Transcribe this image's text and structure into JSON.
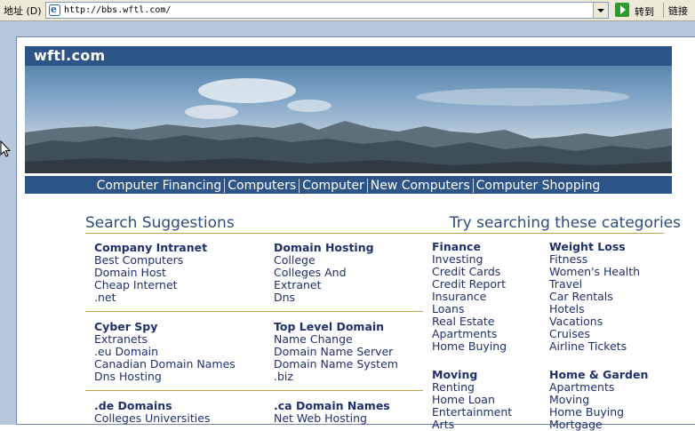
{
  "browser": {
    "address_label": "地址 (D)",
    "url": "http://bbs.wftl.com/",
    "go_label": "转到",
    "links_label": "链接"
  },
  "site": {
    "title": "wftl.com",
    "nav": [
      "Computer Financing",
      "Computers",
      "Computer",
      "New Computers",
      "Computer Shopping"
    ]
  },
  "suggestions": {
    "title": "Search Suggestions",
    "groups": [
      {
        "heading": "Company Intranet",
        "items": [
          "Best Computers",
          "Domain Host",
          "Cheap Internet",
          ".net"
        ]
      },
      {
        "heading": "Domain Hosting",
        "items": [
          "College",
          "Colleges And",
          "Extranet",
          "Dns"
        ]
      },
      {
        "heading": "Cyber Spy",
        "items": [
          "Extranets",
          ".eu Domain",
          "Canadian Domain Names",
          "Dns Hosting"
        ]
      },
      {
        "heading": "Top Level Domain",
        "items": [
          "Name Change",
          "Domain Name Server",
          "Domain Name System",
          ".biz"
        ]
      },
      {
        "heading": ".de Domains",
        "items": [
          "Colleges Universities"
        ]
      },
      {
        "heading": ".ca Domain Names",
        "items": [
          "Net Web Hosting"
        ]
      }
    ]
  },
  "categories": {
    "title": "Try searching these categories",
    "groups": [
      {
        "heading": "Finance",
        "items": [
          "Investing",
          "Credit Cards",
          "Credit Report",
          "Insurance",
          "Loans",
          "Real Estate",
          "Apartments",
          "Home Buying"
        ]
      },
      {
        "heading": "Weight Loss",
        "items": [
          "Fitness",
          "Women's Health",
          "Travel",
          "Car Rentals",
          "Hotels",
          "Vacations",
          "Cruises",
          "Airline Tickets"
        ]
      },
      {
        "heading": "Moving",
        "items": [
          "Renting",
          "Home Loan",
          "Entertainment",
          "Arts"
        ]
      },
      {
        "heading": "Home & Garden",
        "items": [
          "Apartments",
          "Moving",
          "Home Buying",
          "Mortgage"
        ]
      }
    ]
  },
  "colors": {
    "nav_bar": "#2e5588",
    "link_text": "#1f2f6b",
    "rule": "#c9a14a",
    "frame_bg": "#b9c7db"
  }
}
